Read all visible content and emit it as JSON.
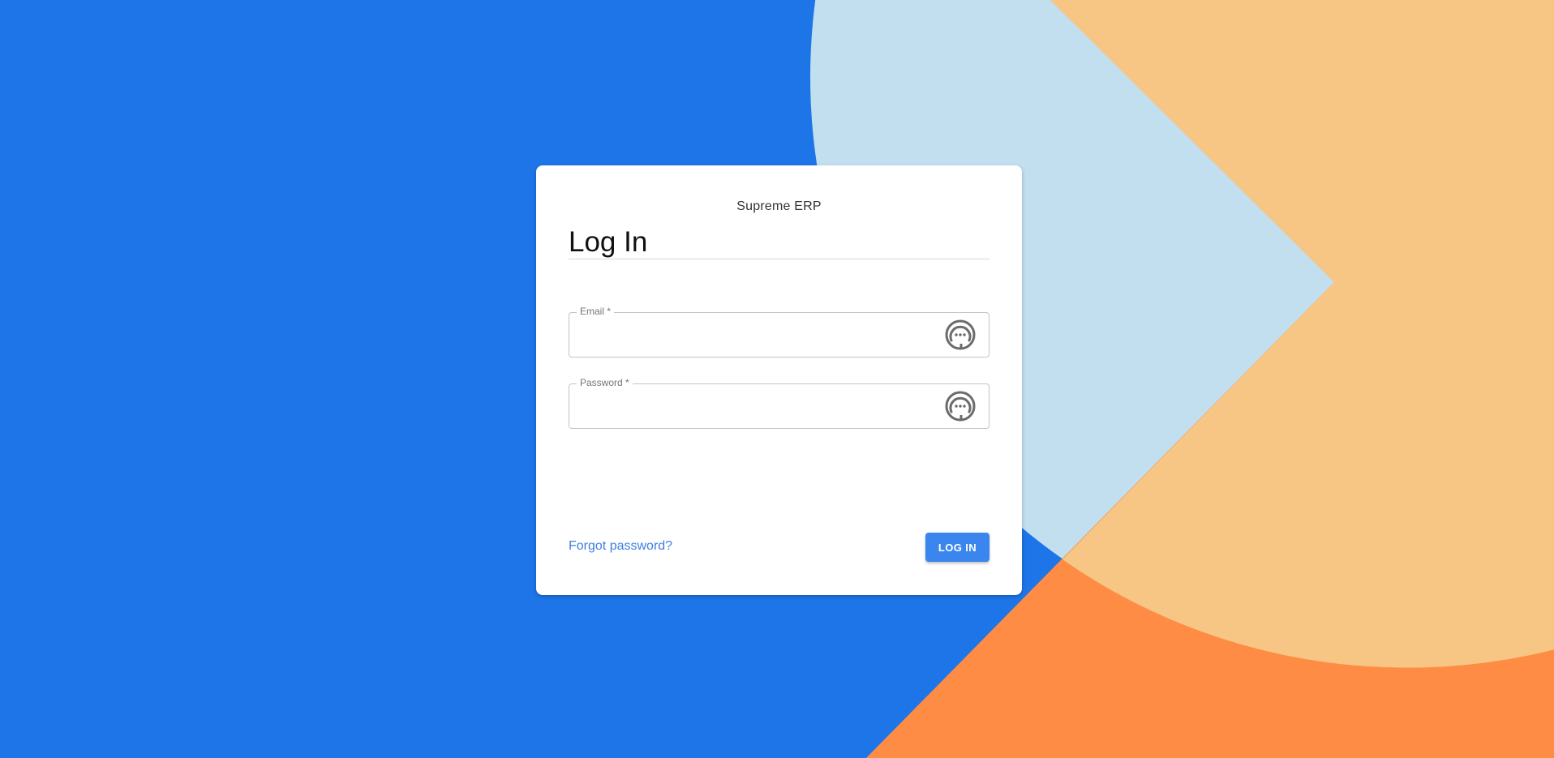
{
  "background": {
    "colors": {
      "blue": "#1d75e8",
      "light_blue": "#c2dff0",
      "peach": "#f7c684",
      "orange": "#ff8c44"
    }
  },
  "login_card": {
    "app_name": "Supreme ERP",
    "title": "Log In",
    "email": {
      "label": "Email *",
      "value": "",
      "icon": "password-manager-icon"
    },
    "password": {
      "label": "Password *",
      "value": "",
      "icon": "password-manager-icon"
    },
    "forgot_password_label": "Forgot password?",
    "login_button_label": "LOG IN",
    "accent_color": "#3a86ee"
  }
}
